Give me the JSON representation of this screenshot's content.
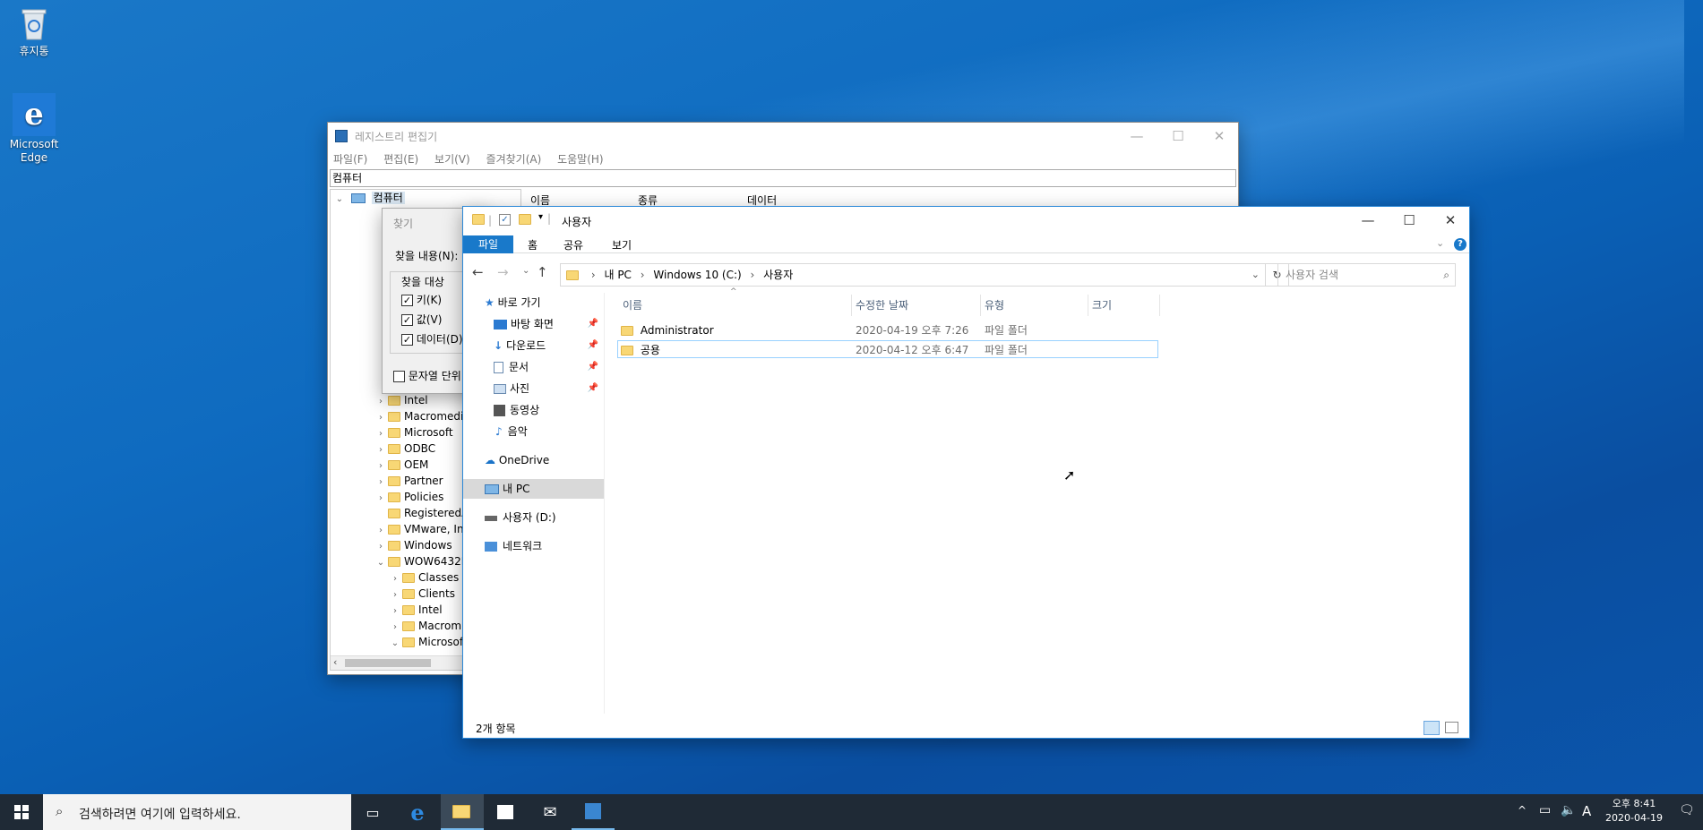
{
  "desktop": {
    "icons": [
      {
        "label": "휴지통",
        "icon": "recycle-bin-icon"
      },
      {
        "label": "Microsoft Edge",
        "icon": "edge-icon"
      }
    ]
  },
  "regedit": {
    "title": "레지스트리 편집기",
    "menu": [
      "파일(F)",
      "편집(E)",
      "보기(V)",
      "즐겨찾기(A)",
      "도움말(H)"
    ],
    "address": "컴퓨터",
    "root": "컴퓨터",
    "columns": [
      "이름",
      "종류",
      "데이터"
    ],
    "tree": [
      "Intel",
      "Macromedi",
      "Microsoft",
      "ODBC",
      "OEM",
      "Partner",
      "Policies",
      "RegisteredA",
      "VMware, In",
      "Windows",
      "WOW6432N",
      "Classes",
      "Clients",
      "Intel",
      "Macrom",
      "Microsof"
    ]
  },
  "find_dialog": {
    "title": "찾기",
    "find_what_label": "찾을 내용(N):",
    "look_at_label": "찾을 대상",
    "options": [
      {
        "label": "키(K)",
        "checked": true
      },
      {
        "label": "값(V)",
        "checked": true
      },
      {
        "label": "데이터(D)",
        "checked": true
      }
    ],
    "whole_string_label": "문자열 단위"
  },
  "explorer": {
    "title": "사용자",
    "ribbon_tabs": [
      "파일",
      "홈",
      "공유",
      "보기"
    ],
    "breadcrumb": [
      "내 PC",
      "Windows 10 (C:)",
      "사용자"
    ],
    "search_placeholder": "사용자 검색",
    "nav": {
      "quick_access": "바로 가기",
      "pinned": [
        "바탕 화면",
        "다운로드",
        "문서",
        "사진"
      ],
      "unpinned": [
        "동영상",
        "음악"
      ],
      "onedrive": "OneDrive",
      "this_pc": "내 PC",
      "drive_d": "사용자 (D:)",
      "network": "네트워크"
    },
    "columns": [
      "이름",
      "수정한 날짜",
      "유형",
      "크기"
    ],
    "files": [
      {
        "name": "Administrator",
        "modified": "2020-04-19 오후 7:26",
        "type": "파일 폴더"
      },
      {
        "name": "공용",
        "modified": "2020-04-12 오후 6:47",
        "type": "파일 폴더"
      }
    ],
    "status": "2개 항목"
  },
  "taskbar": {
    "search_placeholder": "검색하려면 여기에 입력하세요.",
    "ime": "A",
    "time": "오후 8:41",
    "date": "2020-04-19"
  }
}
